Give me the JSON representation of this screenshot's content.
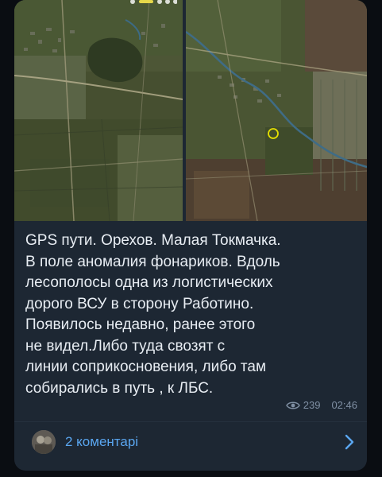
{
  "message": {
    "text": "GPS пути. Орехов. Малая Токмачка.\nВ поле аномалия фонариков. Вдоль\nлесополосы одна из логистических\nдорого ВСУ в сторону Работино.\nПоявилось недавно, ранее этого\nне видел.Либо туда свозят с\nлинии соприкосновения, либо там\nсобирались в путь , к ЛБС.",
    "views": "239",
    "time": "02:46"
  },
  "comments": {
    "label": "2 коментарі"
  },
  "icons": {
    "views": "eye-icon",
    "open_comments": "chevron-right-icon"
  },
  "colors": {
    "bubble": "#1d2733",
    "link": "#5aa6f0",
    "meta": "#7f8fa3",
    "text": "#e8edf3",
    "marker": "#e6e000"
  }
}
